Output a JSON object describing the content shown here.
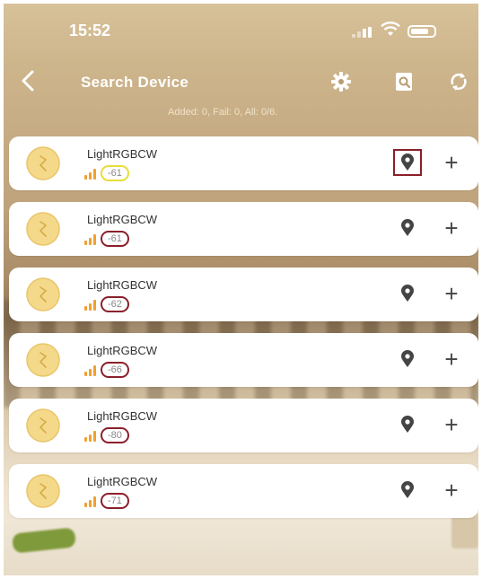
{
  "status_bar": {
    "time": "15:52"
  },
  "nav": {
    "title": "Search Device"
  },
  "summary": "Added: 0, Fail: 0, All: 0/6.",
  "colors": {
    "highlight_yellow": "#e8dc3a",
    "highlight_red": "#8b1f2a",
    "signal_orange": "#f0a030"
  },
  "devices": [
    {
      "name": "LightRGBCW",
      "rssi": "-61"
    },
    {
      "name": "LightRGBCW",
      "rssi": "-61"
    },
    {
      "name": "LightRGBCW",
      "rssi": "-62"
    },
    {
      "name": "LightRGBCW",
      "rssi": "-66"
    },
    {
      "name": "LightRGBCW",
      "rssi": "-80"
    },
    {
      "name": "LightRGBCW",
      "rssi": "-71"
    }
  ],
  "icons": {
    "back": "chevron-left-icon",
    "settings": "gear-icon",
    "search_doc": "search-document-icon",
    "refresh": "refresh-icon",
    "locate": "location-pin-icon",
    "add": "plus-icon"
  }
}
